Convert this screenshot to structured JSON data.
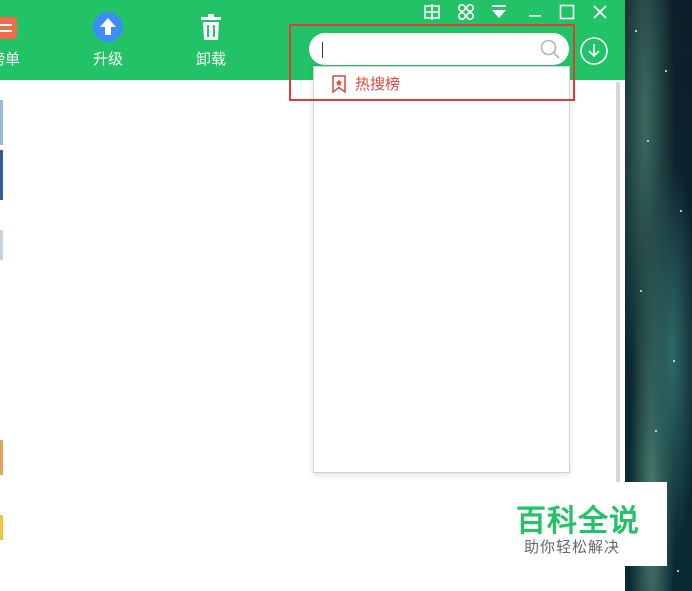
{
  "toolbar": {
    "items": [
      {
        "label": "榜单",
        "icon": "list-icon"
      },
      {
        "label": "升级",
        "icon": "upgrade-arrow-icon"
      },
      {
        "label": "卸载",
        "icon": "trash-icon"
      }
    ]
  },
  "window_controls": [
    "grid-icon",
    "skin-icon",
    "menu-dropdown-icon",
    "minimize-icon",
    "maximize-icon",
    "close-icon"
  ],
  "search": {
    "value": "",
    "placeholder": ""
  },
  "dropdown": {
    "items": [
      {
        "label": "热搜榜",
        "icon": "bookmark-icon"
      }
    ]
  },
  "watermark": {
    "title": "百科全说",
    "subtitle": "助你轻松解决"
  },
  "colors": {
    "brand_green": "#22c266",
    "highlight_red": "#e53935",
    "hot_text": "#e2453b"
  }
}
